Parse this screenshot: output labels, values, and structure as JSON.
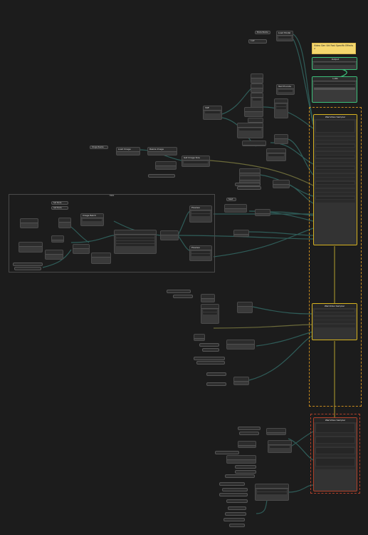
{
  "canvas": {
    "note_text": "Video Gen Vid Fast Specific Effects ∧",
    "group_label": "HDR",
    "wan_video_sampler_label": "WanVideo Sampler",
    "sampler_2_label": "WanVideo Sampler",
    "sampler_3_label": "WanVideo Sampler",
    "output_label": "Output",
    "lora_label": "LoRA"
  },
  "colors": {
    "wire_teal": "#2f5d59",
    "wire_olive": "#6b6a3a",
    "wire_yellow": "#8a7a2a",
    "frame_green": "#3cbf7a",
    "frame_yellow": "#d6b21f",
    "frame_orange": "#c78a1d",
    "frame_red": "#b0402a"
  },
  "nodes": [
    {
      "label": "Model Name"
    },
    {
      "label": "Load Model"
    },
    {
      "label": "CLIP"
    },
    {
      "label": "VAE"
    },
    {
      "label": "Text Encode"
    },
    {
      "label": "Image Resize"
    },
    {
      "label": "Load Image"
    },
    {
      "label": "Resize Image"
    },
    {
      "label": "Get Image Size"
    },
    {
      "label": "Set Node"
    },
    {
      "label": "Get Node"
    },
    {
      "label": "Image Batch"
    },
    {
      "label": "Preview"
    },
    {
      "label": "Seed"
    }
  ]
}
